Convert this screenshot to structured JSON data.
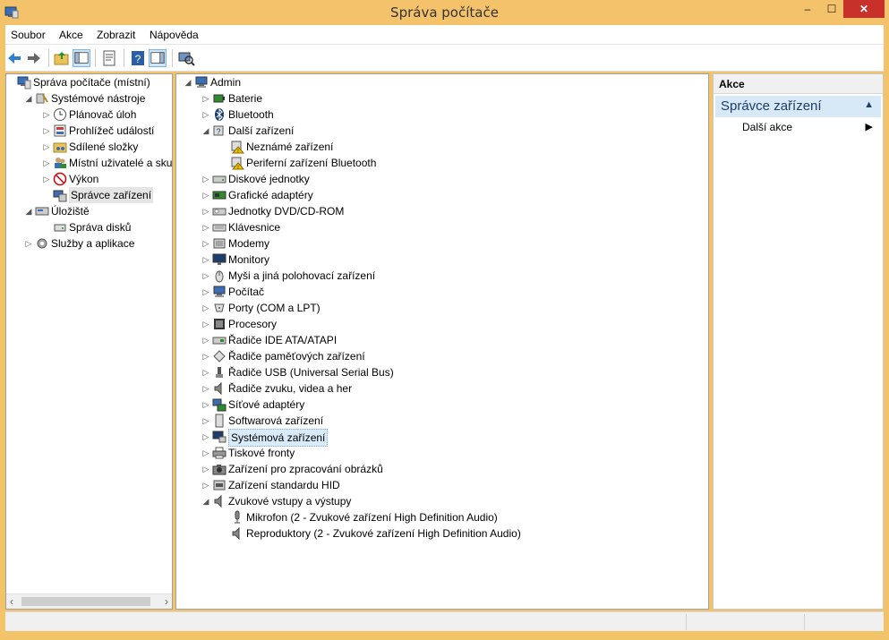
{
  "window": {
    "title": "Správa počítače",
    "min_glyph": "–",
    "max_glyph": "☐",
    "close_glyph": "✕",
    "icon": "computer-management-icon"
  },
  "menu": [
    "Soubor",
    "Akce",
    "Zobrazit",
    "Nápověda"
  ],
  "toolbar_icons": [
    "back-arrow-icon",
    "forward-arrow-icon",
    "up-folder-icon",
    "show-hide-console-tree-icon",
    "properties-icon",
    "help-icon",
    "show-hide-action-pane-icon",
    "scan-hardware-icon"
  ],
  "left_tree": [
    {
      "label": "Správa počítače (místní)",
      "icon": "computer-management-icon",
      "level": 0,
      "expander": ""
    },
    {
      "label": "Systémové nástroje",
      "icon": "system-tools-icon",
      "level": 1,
      "expander": "◢"
    },
    {
      "label": "Plánovač úloh",
      "icon": "clock-icon",
      "level": 2,
      "expander": "▷"
    },
    {
      "label": "Prohlížeč událostí",
      "icon": "event-viewer-icon",
      "level": 2,
      "expander": "▷"
    },
    {
      "label": "Sdílené složky",
      "icon": "shared-folders-icon",
      "level": 2,
      "expander": "▷"
    },
    {
      "label": "Místní uživatelé a skupiny",
      "icon": "users-icon",
      "level": 2,
      "expander": "▷"
    },
    {
      "label": "Výkon",
      "icon": "performance-icon",
      "level": 2,
      "expander": "▷"
    },
    {
      "label": "Správce zařízení",
      "icon": "device-manager-icon",
      "level": 2,
      "expander": "",
      "selected": true
    },
    {
      "label": "Úložiště",
      "icon": "storage-icon",
      "level": 1,
      "expander": "◢"
    },
    {
      "label": "Správa disků",
      "icon": "disk-management-icon",
      "level": 2,
      "expander": ""
    },
    {
      "label": "Služby a aplikace",
      "icon": "services-icon",
      "level": 1,
      "expander": "▷"
    }
  ],
  "center_tree": [
    {
      "label": "Admin",
      "icon": "computer-icon",
      "level": 0,
      "expander": "◢"
    },
    {
      "label": "Baterie",
      "icon": "battery-icon",
      "level": 1,
      "expander": "▷"
    },
    {
      "label": "Bluetooth",
      "icon": "bluetooth-icon",
      "level": 1,
      "expander": "▷"
    },
    {
      "label": "Další zařízení",
      "icon": "unknown-device-icon",
      "level": 1,
      "expander": "◢"
    },
    {
      "label": "Neznámé zařízení",
      "icon": "warning-device-icon",
      "level": 2,
      "expander": ""
    },
    {
      "label": "Periferní zařízení Bluetooth",
      "icon": "warning-device-icon",
      "level": 2,
      "expander": ""
    },
    {
      "label": "Diskové jednotky",
      "icon": "disk-drive-icon",
      "level": 1,
      "expander": "▷"
    },
    {
      "label": "Grafické adaptéry",
      "icon": "display-adapter-icon",
      "level": 1,
      "expander": "▷"
    },
    {
      "label": "Jednotky DVD/CD-ROM",
      "icon": "dvd-drive-icon",
      "level": 1,
      "expander": "▷"
    },
    {
      "label": "Klávesnice",
      "icon": "keyboard-icon",
      "level": 1,
      "expander": "▷"
    },
    {
      "label": "Modemy",
      "icon": "modem-icon",
      "level": 1,
      "expander": "▷"
    },
    {
      "label": "Monitory",
      "icon": "monitor-icon",
      "level": 1,
      "expander": "▷"
    },
    {
      "label": "Myši a jiná polohovací zařízení",
      "icon": "mouse-icon",
      "level": 1,
      "expander": "▷"
    },
    {
      "label": "Počítač",
      "icon": "computer-icon",
      "level": 1,
      "expander": "▷"
    },
    {
      "label": "Porty (COM a LPT)",
      "icon": "port-icon",
      "level": 1,
      "expander": "▷"
    },
    {
      "label": "Procesory",
      "icon": "processor-icon",
      "level": 1,
      "expander": "▷"
    },
    {
      "label": "Řadiče IDE ATA/ATAPI",
      "icon": "ide-controller-icon",
      "level": 1,
      "expander": "▷"
    },
    {
      "label": "Řadiče paměťových zařízení",
      "icon": "storage-controller-icon",
      "level": 1,
      "expander": "▷"
    },
    {
      "label": "Řadiče USB (Universal Serial Bus)",
      "icon": "usb-icon",
      "level": 1,
      "expander": "▷"
    },
    {
      "label": "Řadiče zvuku, videa a her",
      "icon": "speaker-icon",
      "level": 1,
      "expander": "▷"
    },
    {
      "label": "Síťové adaptéry",
      "icon": "network-adapter-icon",
      "level": 1,
      "expander": "▷"
    },
    {
      "label": "Softwarová zařízení",
      "icon": "software-device-icon",
      "level": 1,
      "expander": "▷"
    },
    {
      "label": "Systémová zařízení",
      "icon": "system-device-icon",
      "level": 1,
      "expander": "▷",
      "selected": true
    },
    {
      "label": "Tiskové fronty",
      "icon": "printer-icon",
      "level": 1,
      "expander": "▷"
    },
    {
      "label": "Zařízení pro zpracování obrázků",
      "icon": "imaging-device-icon",
      "level": 1,
      "expander": "▷"
    },
    {
      "label": "Zařízení standardu HID",
      "icon": "hid-icon",
      "level": 1,
      "expander": "▷"
    },
    {
      "label": "Zvukové vstupy a výstupy",
      "icon": "speaker-icon",
      "level": 1,
      "expander": "◢"
    },
    {
      "label": "Mikrofon (2 - Zvukové zařízení High Definition Audio)",
      "icon": "microphone-icon",
      "level": 2,
      "expander": ""
    },
    {
      "label": "Reproduktory (2 - Zvukové zařízení High Definition Audio)",
      "icon": "speaker-icon",
      "level": 2,
      "expander": ""
    }
  ],
  "actions": {
    "header": "Akce",
    "section": "Správce zařízení",
    "section_arrow": "▲",
    "item": "Další akce",
    "item_arrow": "▶"
  },
  "scroll": {
    "left_arrow": "‹",
    "right_arrow": "›"
  }
}
